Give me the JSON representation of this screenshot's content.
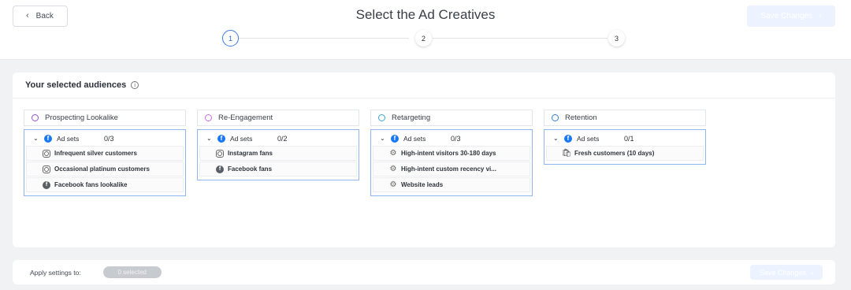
{
  "header": {
    "back_label": "Back",
    "title": "Select the Ad Creatives",
    "save_label": "Save Changes",
    "steps": [
      "1",
      "2",
      "3"
    ]
  },
  "audiences_card": {
    "title": "Your selected audiences",
    "columns": [
      {
        "name": "Prospecting Lookalike",
        "ring_color": "#9b4fd1",
        "set_label": "Ad sets",
        "count": "0/3",
        "items": [
          {
            "icon": "instagram-icon",
            "label": "Infrequent silver customers"
          },
          {
            "icon": "instagram-icon",
            "label": "Occasional platinum customers"
          },
          {
            "icon": "facebook-icon",
            "label": "Facebook fans lookalike"
          }
        ]
      },
      {
        "name": "Re-Engagement",
        "ring_color": "#c76fe0",
        "set_label": "Ad sets",
        "count": "0/2",
        "items": [
          {
            "icon": "instagram-icon",
            "label": "Instagram fans"
          },
          {
            "icon": "facebook-icon",
            "label": "Facebook fans"
          }
        ]
      },
      {
        "name": "Retargeting",
        "ring_color": "#3aa6d6",
        "set_label": "Ad sets",
        "count": "0/3",
        "items": [
          {
            "icon": "custom-audience-icon",
            "label": "High-intent visitors 30-180 days"
          },
          {
            "icon": "custom-audience-icon",
            "label": "High-intent custom recency vi..."
          },
          {
            "icon": "custom-audience-icon",
            "label": "Website leads"
          }
        ]
      },
      {
        "name": "Retention",
        "ring_color": "#2f7fd8",
        "set_label": "Ad sets",
        "count": "0/1",
        "items": [
          {
            "icon": "shopping-bag-icon",
            "label": "Fresh customers (10 days)"
          }
        ]
      }
    ]
  },
  "footer": {
    "apply_label": "Apply settings to:",
    "selected_pill": "0 selected",
    "save_label": "Save Changes"
  },
  "colors": {
    "accent": "#3d7be0",
    "facebook": "#1877f2",
    "selection_border": "#8fb6ee"
  }
}
